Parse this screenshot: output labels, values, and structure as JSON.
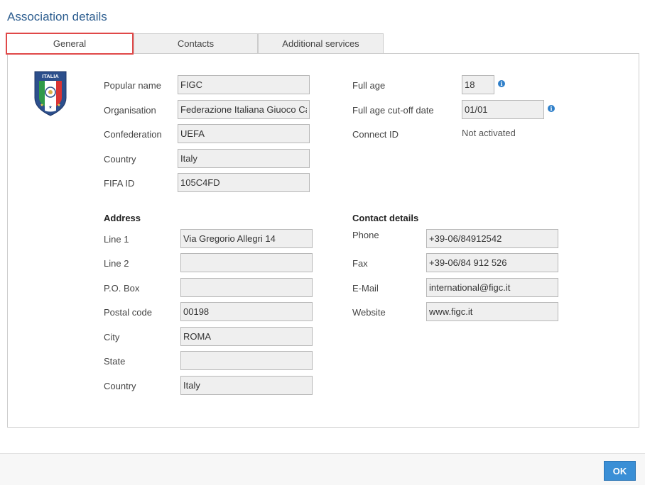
{
  "dialog": {
    "title": "Association details"
  },
  "tabs": [
    {
      "label": "General",
      "active": true
    },
    {
      "label": "Contacts",
      "active": false
    },
    {
      "label": "Additional services",
      "active": false
    }
  ],
  "crest": {
    "icon": "figc-italia-crest",
    "text": "ITALIA"
  },
  "general": {
    "popular_name": {
      "label": "Popular name",
      "value": "FIGC"
    },
    "organisation": {
      "label": "Organisation",
      "value": "Federazione Italiana Giuoco Calcio"
    },
    "confederation": {
      "label": "Confederation",
      "value": "UEFA"
    },
    "country": {
      "label": "Country",
      "value": "Italy"
    },
    "fifa_id": {
      "label": "FIFA ID",
      "value": "105C4FD"
    },
    "full_age": {
      "label": "Full age",
      "value": "18"
    },
    "full_age_cutoff": {
      "label": "Full age cut-off date",
      "value": "01/01"
    },
    "connect_id": {
      "label": "Connect ID",
      "value": "Not activated"
    }
  },
  "address": {
    "title": "Address",
    "line1": {
      "label": "Line 1",
      "value": "Via Gregorio Allegri 14"
    },
    "line2": {
      "label": "Line 2",
      "value": ""
    },
    "po_box": {
      "label": "P.O. Box",
      "value": ""
    },
    "postal_code": {
      "label": "Postal code",
      "value": "00198"
    },
    "city": {
      "label": "City",
      "value": "ROMA"
    },
    "state": {
      "label": "State",
      "value": ""
    },
    "country": {
      "label": "Country",
      "value": "Italy"
    }
  },
  "contact": {
    "title": "Contact details",
    "phone": {
      "label": "Phone",
      "value": "+39-06/84912542"
    },
    "fax": {
      "label": "Fax",
      "value": "+39-06/84 912 526"
    },
    "email": {
      "label": "E-Mail",
      "value": "international@figc.it"
    },
    "website": {
      "label": "Website",
      "value": "www.figc.it"
    }
  },
  "footer": {
    "ok_label": "OK"
  },
  "icons": {
    "info": "info-icon"
  },
  "colors": {
    "title": "#2c5d8f",
    "active_tab_border": "#e04848",
    "ok_button": "#3a8fd6",
    "info_icon": "#2f7fc9",
    "field_bg": "#efefef"
  }
}
